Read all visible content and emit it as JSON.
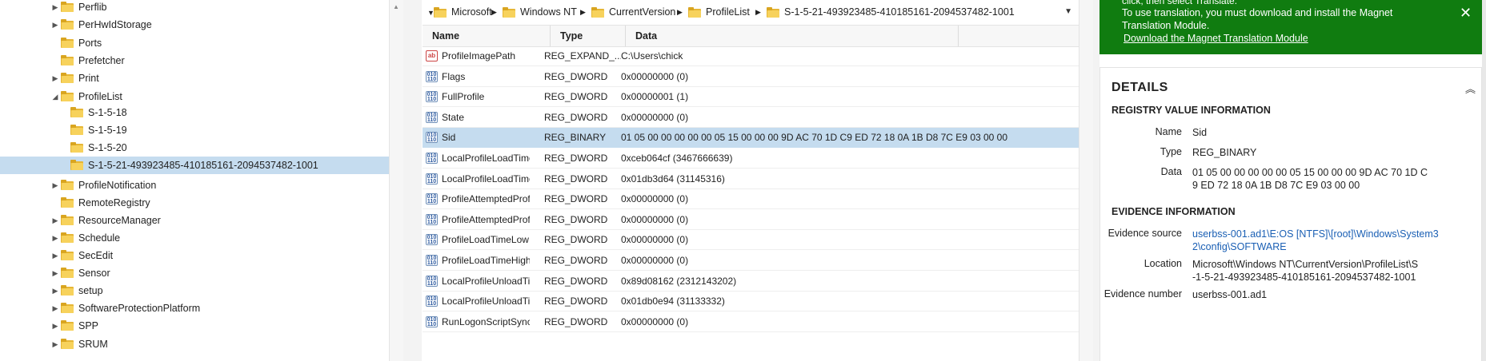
{
  "tree": {
    "items": [
      {
        "label": "Perflib",
        "expander": "▶",
        "level": 1
      },
      {
        "label": "PerHwIdStorage",
        "expander": "▶",
        "level": 1
      },
      {
        "label": "Ports",
        "expander": "",
        "level": 1
      },
      {
        "label": "Prefetcher",
        "expander": "",
        "level": 1
      },
      {
        "label": "Print",
        "expander": "▶",
        "level": 1
      },
      {
        "label": "ProfileList",
        "expander": "◢",
        "level": 1
      },
      {
        "label": "S-1-5-18",
        "expander": "",
        "level": 2
      },
      {
        "label": "S-1-5-19",
        "expander": "",
        "level": 2
      },
      {
        "label": "S-1-5-20",
        "expander": "",
        "level": 2
      },
      {
        "label": "S-1-5-21-493923485-410185161-2094537482-1001",
        "expander": "",
        "level": 2,
        "selected": true
      },
      {
        "label": "ProfileNotification",
        "expander": "▶",
        "level": 1
      },
      {
        "label": "RemoteRegistry",
        "expander": "",
        "level": 1
      },
      {
        "label": "ResourceManager",
        "expander": "▶",
        "level": 1
      },
      {
        "label": "Schedule",
        "expander": "▶",
        "level": 1
      },
      {
        "label": "SecEdit",
        "expander": "▶",
        "level": 1
      },
      {
        "label": "Sensor",
        "expander": "▶",
        "level": 1
      },
      {
        "label": "setup",
        "expander": "▶",
        "level": 1
      },
      {
        "label": "SoftwareProtectionPlatform",
        "expander": "▶",
        "level": 1
      },
      {
        "label": "SPP",
        "expander": "▶",
        "level": 1
      },
      {
        "label": "SRUM",
        "expander": "▶",
        "level": 1
      }
    ]
  },
  "breadcrumb": {
    "items": [
      "Microsoft",
      "Windows NT",
      "CurrentVersion",
      "ProfileList",
      "S-1-5-21-493923485-410185161-2094537482-1001"
    ],
    "dropdown_glyph": "▼"
  },
  "list": {
    "columns": {
      "name": "Name",
      "type": "Type",
      "data": "Data"
    },
    "rows": [
      {
        "name": "ProfileImagePath",
        "type": "REG_EXPAND_...",
        "data": "C:\\Users\\chick",
        "icon": "string-value-icon"
      },
      {
        "name": "Flags",
        "type": "REG_DWORD",
        "data": "0x00000000 (0)",
        "icon": "binary-value-icon"
      },
      {
        "name": "FullProfile",
        "type": "REG_DWORD",
        "data": "0x00000001 (1)",
        "icon": "binary-value-icon"
      },
      {
        "name": "State",
        "type": "REG_DWORD",
        "data": "0x00000000 (0)",
        "icon": "binary-value-icon"
      },
      {
        "name": "Sid",
        "type": "REG_BINARY",
        "data": "01 05 00 00 00 00 00 05 15 00 00 00 9D AC 70 1D C9 ED 72 18 0A 1B D8 7C E9 03 00 00",
        "icon": "binary-value-icon",
        "selected": true
      },
      {
        "name": "LocalProfileLoadTimeLow",
        "type": "REG_DWORD",
        "data": "0xceb064cf (3467666639)",
        "icon": "binary-value-icon"
      },
      {
        "name": "LocalProfileLoadTimeHigh",
        "type": "REG_DWORD",
        "data": "0x01db3d64 (31145316)",
        "icon": "binary-value-icon"
      },
      {
        "name": "ProfileAttemptedProfileDownloadTimeLow",
        "type": "REG_DWORD",
        "data": "0x00000000 (0)",
        "icon": "binary-value-icon"
      },
      {
        "name": "ProfileAttemptedProfileDownloadTimeHigh",
        "type": "REG_DWORD",
        "data": "0x00000000 (0)",
        "icon": "binary-value-icon"
      },
      {
        "name": "ProfileLoadTimeLow",
        "type": "REG_DWORD",
        "data": "0x00000000 (0)",
        "icon": "binary-value-icon"
      },
      {
        "name": "ProfileLoadTimeHigh",
        "type": "REG_DWORD",
        "data": "0x00000000 (0)",
        "icon": "binary-value-icon"
      },
      {
        "name": "LocalProfileUnloadTimeLow",
        "type": "REG_DWORD",
        "data": "0x89d08162 (2312143202)",
        "icon": "binary-value-icon"
      },
      {
        "name": "LocalProfileUnloadTimeHigh",
        "type": "REG_DWORD",
        "data": "0x01db0e94 (31133332)",
        "icon": "binary-value-icon"
      },
      {
        "name": "RunLogonScriptSync",
        "type": "REG_DWORD",
        "data": "0x00000000 (0)",
        "icon": "binary-value-icon"
      }
    ]
  },
  "banner": {
    "cut_text": "click, then select Translate.",
    "message": "To use translation, you must download and install the Magnet Translation Module.",
    "link": "Download the Magnet Translation Module",
    "close_glyph": "✕",
    "color": "#107c10"
  },
  "details": {
    "title": "DETAILS",
    "collapse_glyph": "︽",
    "registry_section": "REGISTRY VALUE INFORMATION",
    "name_label": "Name",
    "name_value": "Sid",
    "type_label": "Type",
    "type_value": "REG_BINARY",
    "data_label": "Data",
    "data_value": "01 05 00 00 00 00 00 05 15 00 00 00 9D AC 70 1D C9 ED 72 18 0A 1B D8 7C E9 03 00 00",
    "evidence_section": "EVIDENCE INFORMATION",
    "source_label": "Evidence source",
    "source_value": "userbss-001.ad1\\E:OS [NTFS]\\[root]\\Windows\\System32\\config\\SOFTWARE",
    "location_label": "Location",
    "location_value": "Microsoft\\Windows NT\\CurrentVersion\\ProfileList\\S-1-5-21-493923485-410185161-2094537482-1001",
    "number_label": "Evidence number",
    "number_value": "userbss-001.ad1"
  }
}
